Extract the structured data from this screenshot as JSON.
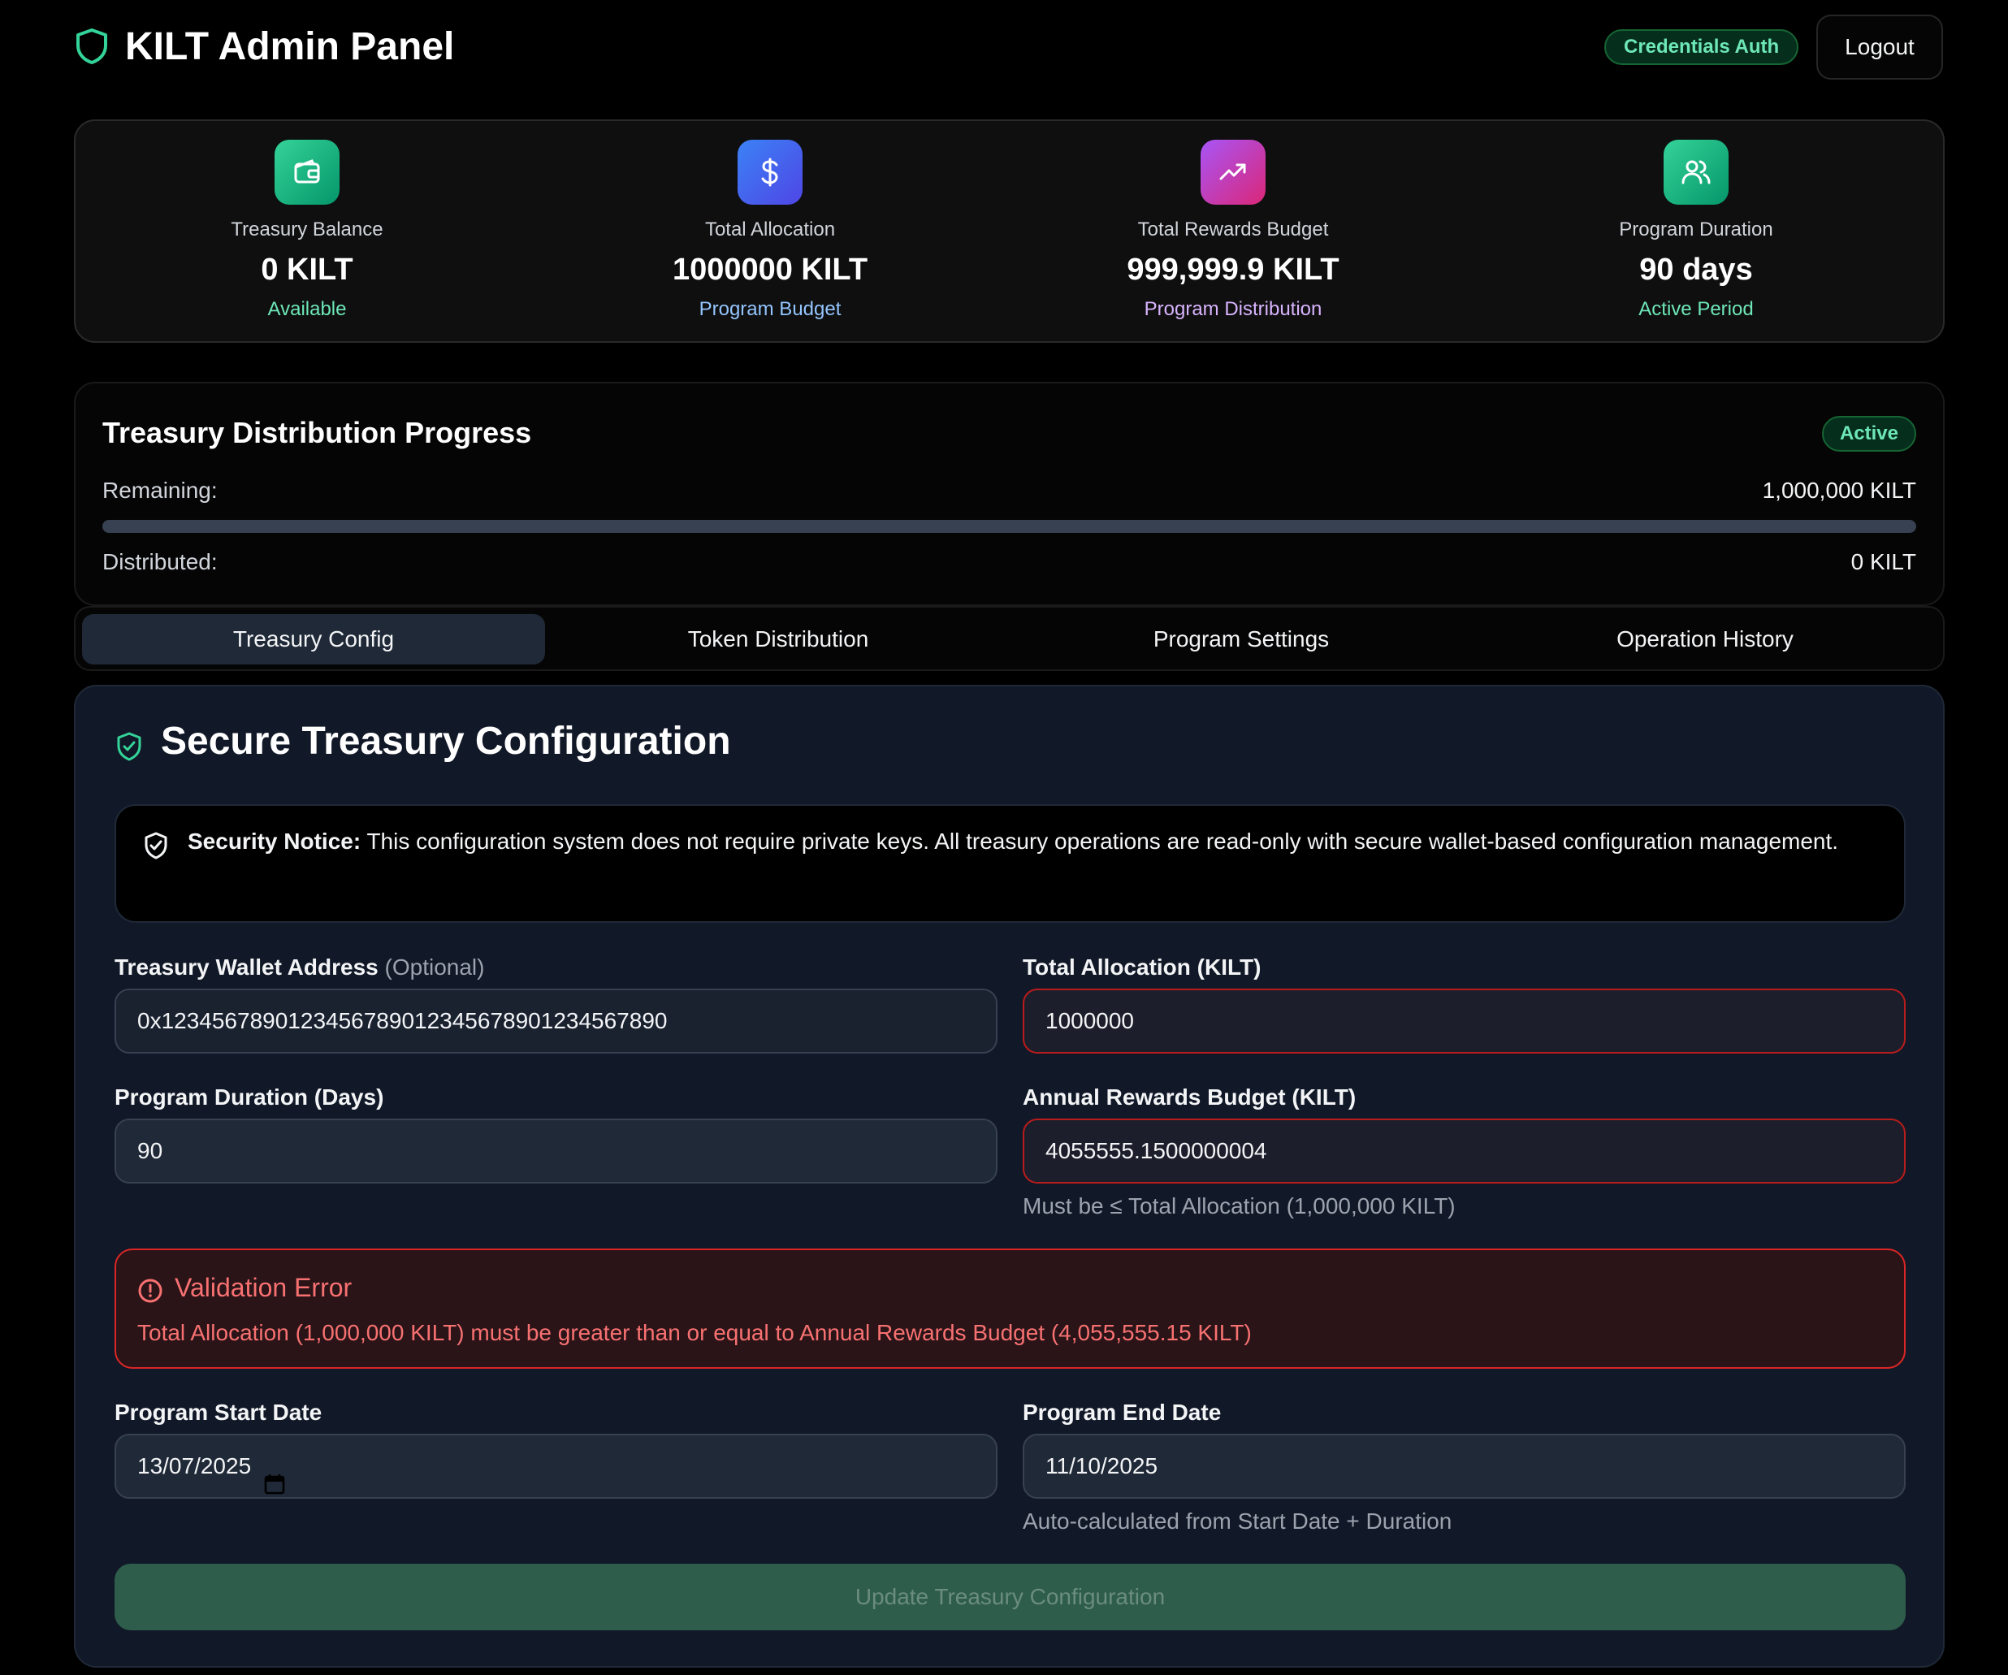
{
  "header": {
    "title": "KILT Admin Panel",
    "auth_badge": "Credentials Auth",
    "logout_label": "Logout"
  },
  "stats": [
    {
      "label": "Treasury Balance",
      "value": "0 KILT",
      "sub": "Available",
      "icon": "wallet-icon",
      "color": "#34d399"
    },
    {
      "label": "Total Allocation",
      "value": "1000000 KILT",
      "sub": "Program Budget",
      "icon": "dollar-icon",
      "color": "#93c5fd"
    },
    {
      "label": "Total Rewards Budget",
      "value": "999,999.9 KILT",
      "sub": "Program Distribution",
      "icon": "trending-up-icon",
      "color": "#d8b4fe"
    },
    {
      "label": "Program Duration",
      "value": "90 days",
      "sub": "Active Period",
      "icon": "users-icon",
      "color": "#6ee7b7"
    }
  ],
  "progress": {
    "title": "Treasury Distribution Progress",
    "status": "Active",
    "remaining_label": "Remaining:",
    "remaining_value": "1,000,000 KILT",
    "distributed_label": "Distributed:",
    "distributed_value": "0 KILT",
    "percent_distributed": 0
  },
  "tabs": [
    {
      "label": "Treasury Config",
      "active": true
    },
    {
      "label": "Token Distribution",
      "active": false
    },
    {
      "label": "Program Settings",
      "active": false
    },
    {
      "label": "Operation History",
      "active": false
    }
  ],
  "config": {
    "title": "Secure Treasury Configuration",
    "notice_bold": "Security Notice:",
    "notice_text": " This configuration system does not require private keys. All treasury operations are read-only with secure wallet-based configuration management.",
    "wallet_label": "Treasury Wallet Address",
    "wallet_optional": "(Optional)",
    "wallet_value": "0x1234567890123456789012345678901234567890",
    "allocation_label": "Total Allocation (KILT)",
    "allocation_value": "1000000",
    "duration_label": "Program Duration (Days)",
    "duration_value": "90",
    "rewards_label": "Annual Rewards Budget (KILT)",
    "rewards_value": "4055555.1500000004",
    "rewards_hint": "Must be ≤ Total Allocation (1,000,000 KILT)",
    "error_title": "Validation Error",
    "error_message": "Total Allocation (1,000,000 KILT) must be greater than or equal to Annual Rewards Budget (4,055,555.15 KILT)",
    "start_label": "Program Start Date",
    "start_value": "13/07/2025",
    "end_label": "Program End Date",
    "end_value": "11/10/2025",
    "end_hint": "Auto-calculated from Start Date + Duration",
    "submit_label": "Update Treasury Configuration"
  },
  "colors": {
    "accent_green": "#34d399",
    "error_red": "#f87171"
  }
}
